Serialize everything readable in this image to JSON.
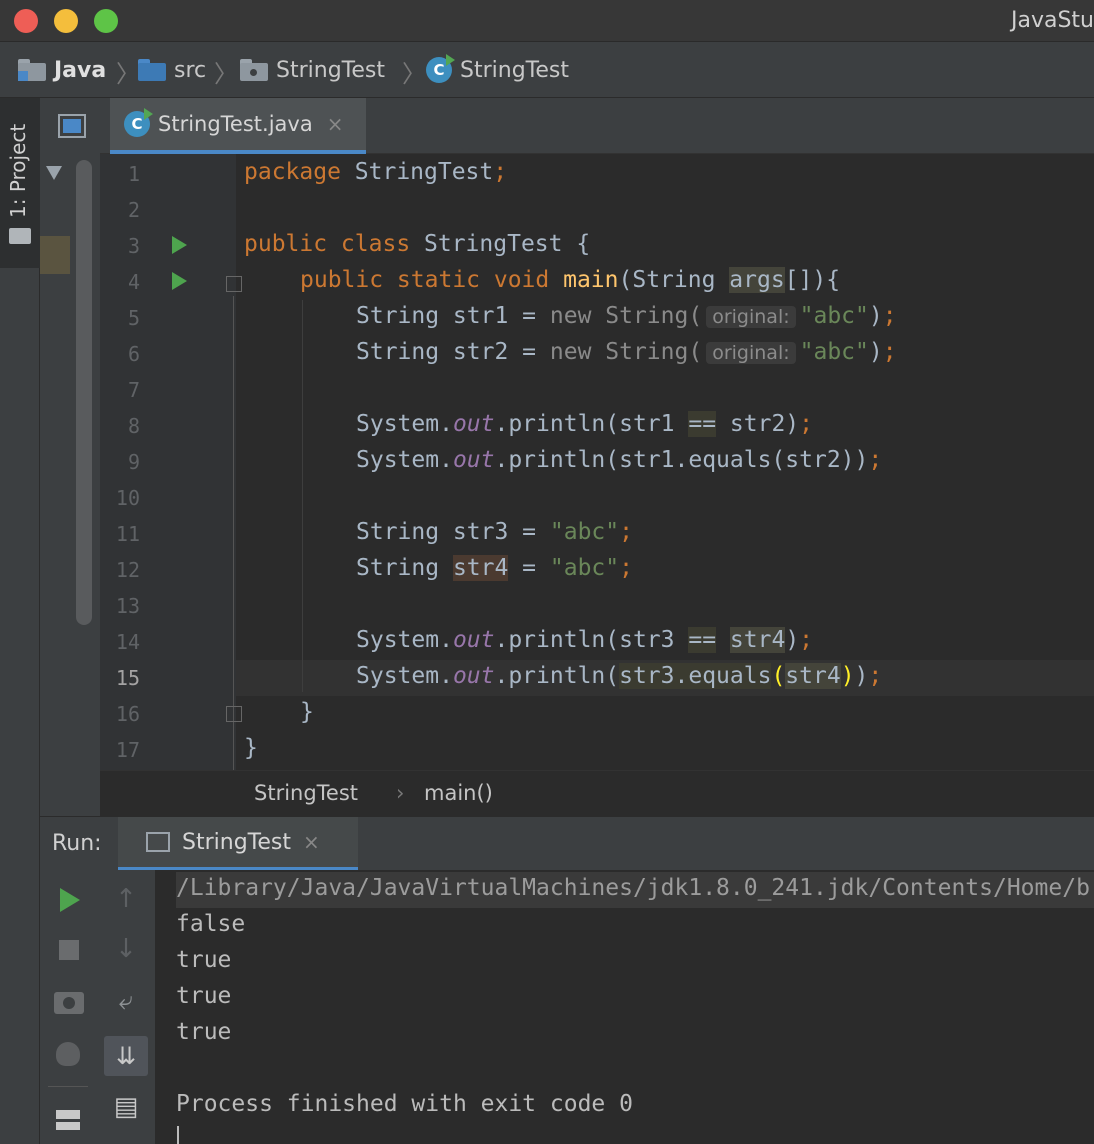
{
  "window": {
    "title": "JavaStu"
  },
  "breadcrumb": {
    "items": [
      {
        "label": "Java",
        "icon": "module-folder-icon"
      },
      {
        "label": "src",
        "icon": "source-folder-icon"
      },
      {
        "label": "StringTest",
        "icon": "package-folder-icon"
      },
      {
        "label": "StringTest",
        "icon": "java-class-icon"
      }
    ]
  },
  "left_strip": {
    "project_label": "1: Project"
  },
  "tabs": [
    {
      "label": "StringTest.java",
      "close": "×"
    }
  ],
  "editor": {
    "line_numbers": [
      "1",
      "2",
      "3",
      "4",
      "5",
      "6",
      "7",
      "8",
      "9",
      "10",
      "11",
      "12",
      "13",
      "14",
      "15",
      "16",
      "17"
    ],
    "current_line": "15",
    "hint_label": "original:",
    "code": {
      "l1_kw": "package",
      "l1_rest": " StringTest",
      "semi": ";",
      "l3_kw": "public class",
      "l3_rest": " StringTest {",
      "l4_kw": "public static void",
      "l4_fn": "main",
      "l4_a": "(String ",
      "l4_args": "args",
      "l4_b": "[]){",
      "l5_a": "String str1 = ",
      "new": "new",
      "l5_b": " String(",
      "abc": "\"abc\"",
      "close_paren": ")",
      "l6_a": "String str2 = ",
      "sys": "System.",
      "out": "out",
      "println": ".println(",
      "l8_a": "str1 ",
      "eq": "==",
      "l8_b": " str2)",
      "l9_a": "str1.equals(str2))",
      "l11_a": "String str3 = ",
      "l12_a": "String ",
      "str4": "str4",
      "l12_b": " = ",
      "l14_a": "str3 ",
      "l14_b": ")",
      "l15_a": "str3.equals",
      "open": "(",
      "l15_str4": "str4",
      "l15_b": ")",
      "l16": "}",
      "l17": "}"
    }
  },
  "editor_breadcrumb": {
    "class": "StringTest",
    "sep": "›",
    "method": "main()"
  },
  "run_panel": {
    "label": "Run:",
    "tab": "StringTest",
    "close": "×",
    "console": [
      "/Library/Java/JavaVirtualMachines/jdk1.8.0_241.jdk/Contents/Home/b",
      "false",
      "true",
      "true",
      "true",
      "",
      "Process finished with exit code 0"
    ]
  },
  "colors": {
    "keyword": "#cc7832",
    "string": "#6a8759",
    "function": "#ffc66d",
    "field": "#9876aa",
    "accent": "#4a88c7"
  }
}
